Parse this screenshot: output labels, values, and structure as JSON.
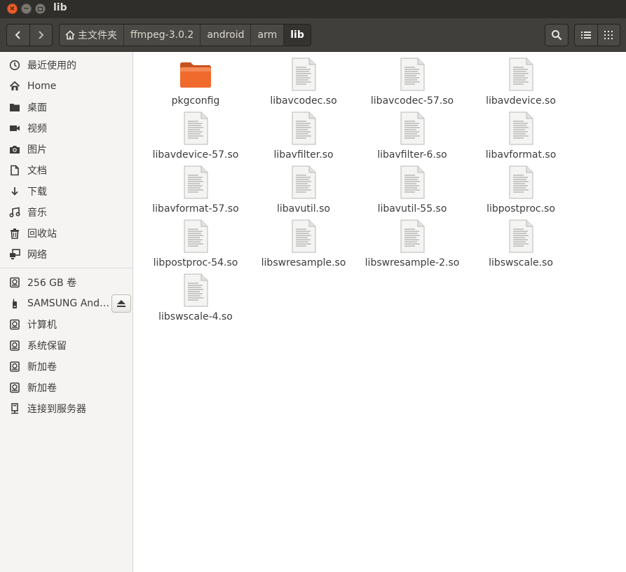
{
  "window": {
    "title": "lib"
  },
  "toolbar": {
    "back_icon": "chevron-left-icon",
    "forward_icon": "chevron-right-icon",
    "breadcrumbs": [
      "主文件夹",
      "ffmpeg-3.0.2",
      "android",
      "arm",
      "lib"
    ],
    "search_icon": "search-icon",
    "list_view_icon": "list-view-icon",
    "grid_view_icon": "grid-view-icon"
  },
  "sidebar": {
    "places": [
      {
        "label": "最近使用的",
        "icon": "clock-icon"
      },
      {
        "label": "Home",
        "icon": "home-icon"
      },
      {
        "label": "桌面",
        "icon": "folder-icon"
      },
      {
        "label": "视频",
        "icon": "video-icon"
      },
      {
        "label": "图片",
        "icon": "camera-icon"
      },
      {
        "label": "文档",
        "icon": "document-icon"
      },
      {
        "label": "下载",
        "icon": "download-icon"
      },
      {
        "label": "音乐",
        "icon": "music-icon"
      },
      {
        "label": "回收站",
        "icon": "trash-icon"
      },
      {
        "label": "网络",
        "icon": "network-icon"
      }
    ],
    "devices": [
      {
        "label": "256 GB 卷",
        "icon": "drive-icon"
      },
      {
        "label": "SAMSUNG Android",
        "icon": "phone-icon",
        "eject": true
      },
      {
        "label": "计算机",
        "icon": "drive-icon"
      },
      {
        "label": "系统保留",
        "icon": "drive-icon"
      },
      {
        "label": "新加卷",
        "icon": "drive-icon"
      },
      {
        "label": "新加卷",
        "icon": "drive-icon"
      },
      {
        "label": "连接到服务器",
        "icon": "server-icon"
      }
    ]
  },
  "files": [
    {
      "name": "pkgconfig",
      "type": "folder"
    },
    {
      "name": "libavcodec.so",
      "type": "file"
    },
    {
      "name": "libavcodec-57.so",
      "type": "file"
    },
    {
      "name": "libavdevice.so",
      "type": "file"
    },
    {
      "name": "libavdevice-57.so",
      "type": "file"
    },
    {
      "name": "libavfilter.so",
      "type": "file"
    },
    {
      "name": "libavfilter-6.so",
      "type": "file"
    },
    {
      "name": "libavformat.so",
      "type": "file"
    },
    {
      "name": "libavformat-57.so",
      "type": "file"
    },
    {
      "name": "libavutil.so",
      "type": "file"
    },
    {
      "name": "libavutil-55.so",
      "type": "file"
    },
    {
      "name": "libpostproc.so",
      "type": "file"
    },
    {
      "name": "libpostproc-54.so",
      "type": "file"
    },
    {
      "name": "libswresample.so",
      "type": "file"
    },
    {
      "name": "libswresample-2.so",
      "type": "file"
    },
    {
      "name": "libswscale.so",
      "type": "file"
    },
    {
      "name": "libswscale-4.so",
      "type": "file"
    }
  ],
  "colors": {
    "titlebar": "#2f2e2b",
    "toolbar": "#403f3b",
    "close": "#e95e2b",
    "folder": "#f0692d"
  }
}
